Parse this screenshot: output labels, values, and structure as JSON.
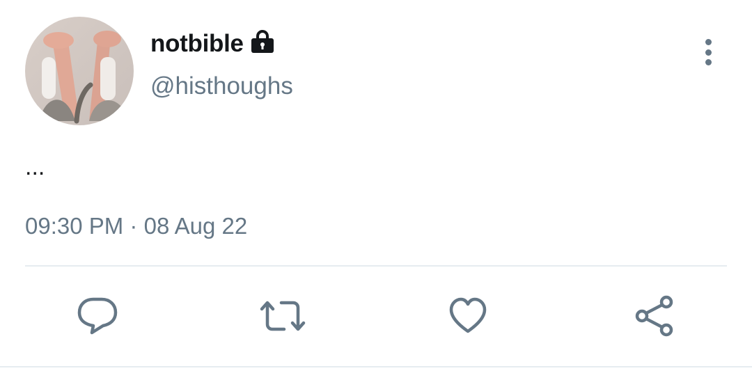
{
  "user": {
    "display_name": "notbible",
    "handle": "@histhoughs",
    "protected_icon": "lock-icon"
  },
  "tweet": {
    "text": "...",
    "time": "09:30 PM",
    "separator": "·",
    "date": "08 Aug 22"
  },
  "actions": {
    "reply_icon": "reply-icon",
    "retweet_icon": "retweet-icon",
    "like_icon": "heart-icon",
    "share_icon": "share-icon",
    "more_icon": "more-vertical-icon"
  },
  "colors": {
    "primary_text": "#14171a",
    "secondary_text": "#657786",
    "divider": "#e6ecf0"
  }
}
